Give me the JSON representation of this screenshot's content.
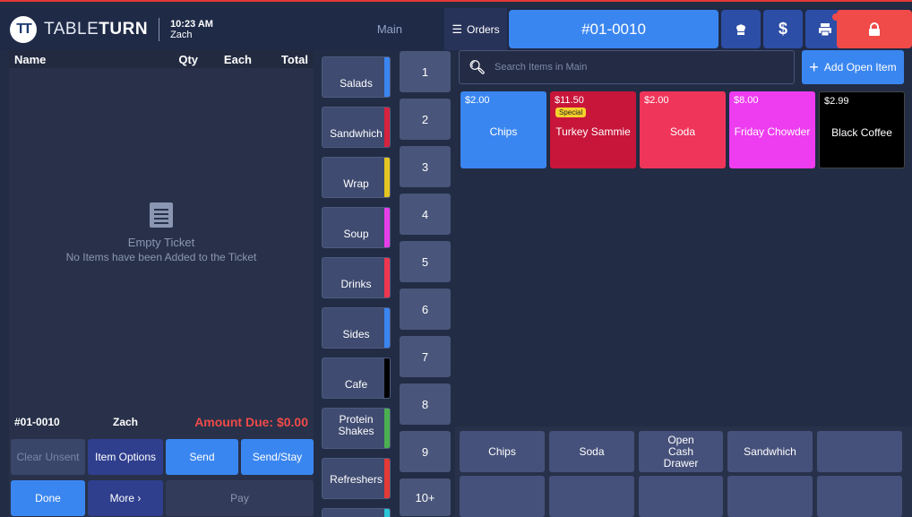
{
  "header": {
    "brand_light": "TABLE",
    "brand_bold": "TURN",
    "logo_text": "TT",
    "time": "10:23 AM",
    "user": "Zach",
    "main_tab": "Main",
    "orders_label": "Orders",
    "ticket_number": "#01-0010",
    "icons": [
      "chef-hat-icon",
      "dollar-icon",
      "printer-icon",
      "lock-icon"
    ]
  },
  "ticket": {
    "columns": [
      "Name",
      "Qty",
      "Each",
      "Total"
    ],
    "empty_title": "Empty Ticket",
    "empty_message": "No Items have been Added to the Ticket",
    "number": "#01-0010",
    "server": "Zach",
    "amount_due": "Amount Due: $0.00",
    "buttons": {
      "clear_unsent": "Clear Unsent",
      "item_options": "Item Options",
      "send": "Send",
      "send_stay": "Send/Stay",
      "done": "Done",
      "more": "More ›",
      "pay": "Pay"
    }
  },
  "categories": [
    {
      "label": "Salads",
      "color": "#3a86f0"
    },
    {
      "label": "Sandwhich",
      "color": "#d6223d"
    },
    {
      "label": "Wrap",
      "color": "#e4c521"
    },
    {
      "label": "Soup",
      "color": "#e63ee8"
    },
    {
      "label": "Drinks",
      "color": "#f0354f"
    },
    {
      "label": "Sides",
      "color": "#3a86f0"
    },
    {
      "label": "Cafe",
      "color": "#000000"
    },
    {
      "label": "Protein Shakes",
      "color": "#4caf50"
    },
    {
      "label": "Refreshers",
      "color": "#e53935"
    }
  ],
  "numbers": [
    "1",
    "2",
    "3",
    "4",
    "5",
    "6",
    "7",
    "8",
    "9",
    "10+"
  ],
  "search": {
    "placeholder": "Search Items in Main"
  },
  "add_open_item": "Add Open Item",
  "items": [
    {
      "price": "$2.00",
      "name": "Chips",
      "color": "#3a86f0",
      "badge": ""
    },
    {
      "price": "$11.50",
      "name": "Turkey Sammie",
      "color": "#c8153a",
      "badge": "Special"
    },
    {
      "price": "$2.00",
      "name": "Soda",
      "color": "#f0355a",
      "badge": ""
    },
    {
      "price": "$8.00",
      "name": "Friday Chowder",
      "color": "#ee3cf0",
      "badge": ""
    },
    {
      "price": "$2.99",
      "name": "Black Coffee",
      "color": "#000000",
      "badge": ""
    }
  ],
  "quick_buttons": [
    "Chips",
    "Soda",
    "Open Cash Drawer",
    "Sandwhich",
    ""
  ]
}
